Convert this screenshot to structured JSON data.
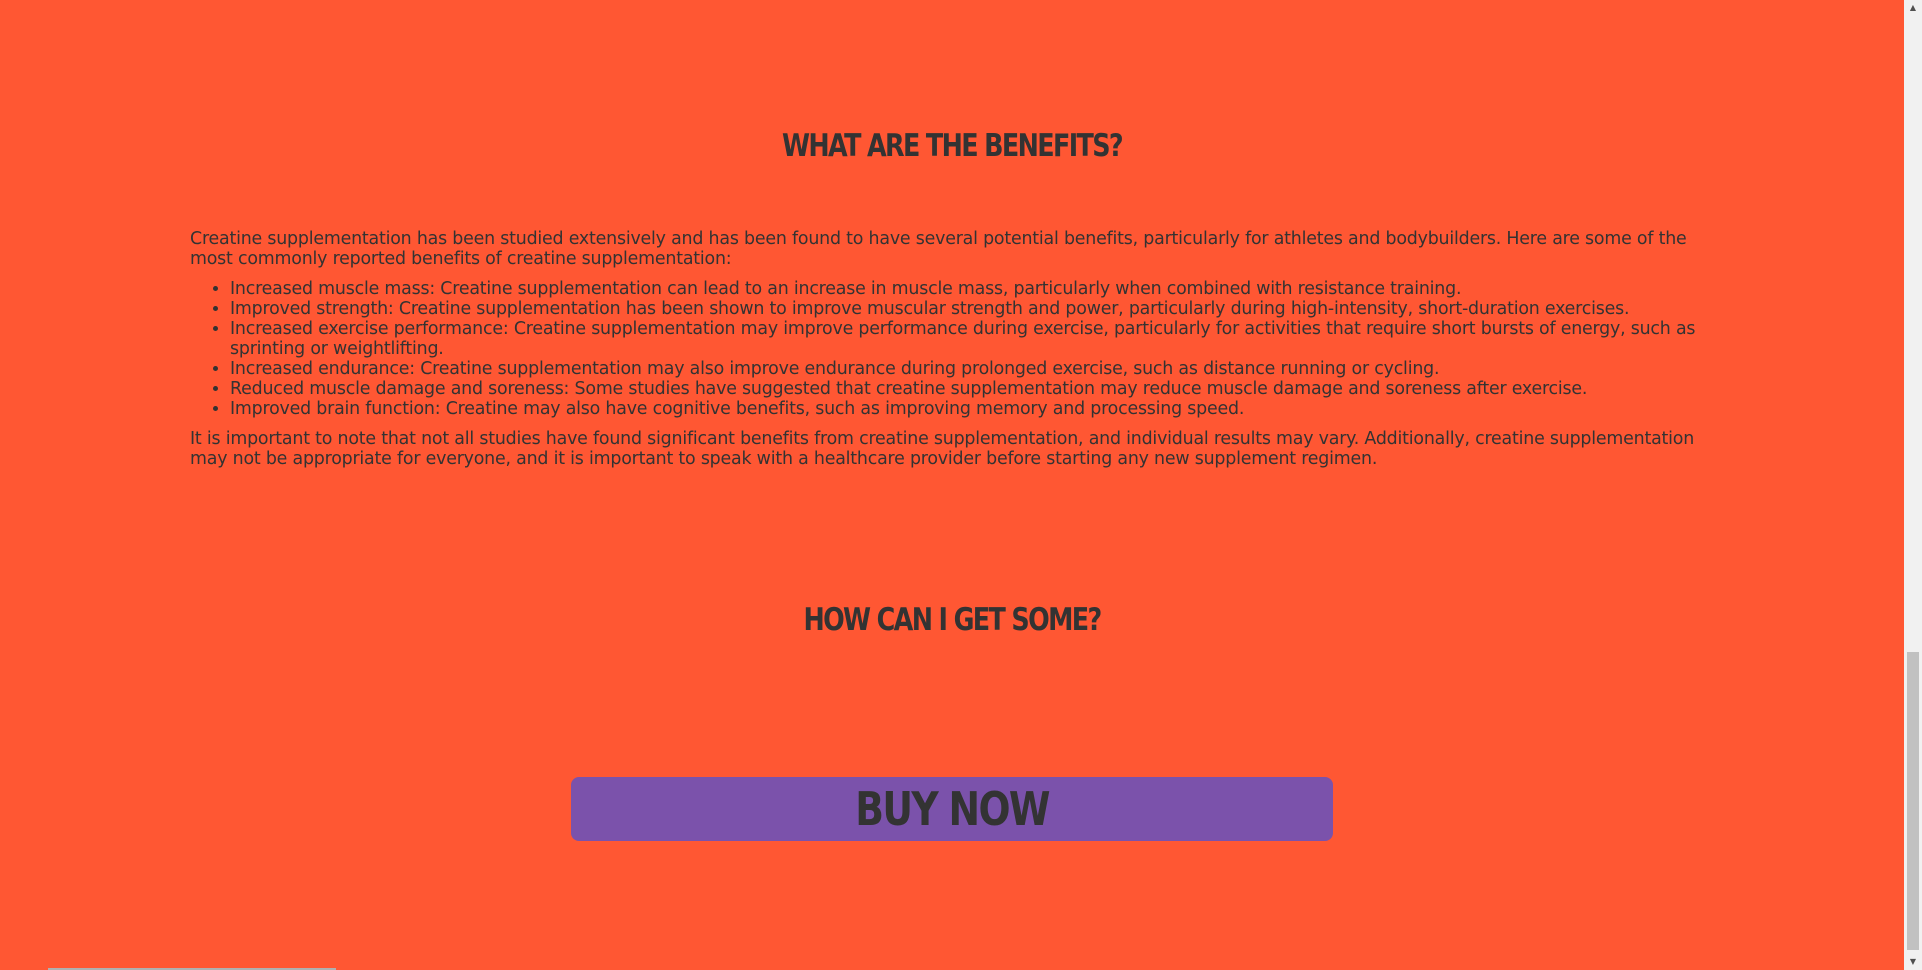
{
  "sections": {
    "benefits": {
      "heading": "WHAT ARE THE BENEFITS?",
      "intro": "Creatine supplementation has been studied extensively and has been found to have several potential benefits, particularly for athletes and bodybuilders. Here are some of the most commonly reported benefits of creatine supplementation:",
      "items": [
        "Increased muscle mass: Creatine supplementation can lead to an increase in muscle mass, particularly when combined with resistance training.",
        "Improved strength: Creatine supplementation has been shown to improve muscular strength and power, particularly during high-intensity, short-duration exercises.",
        "Increased exercise performance: Creatine supplementation may improve performance during exercise, particularly for activities that require short bursts of energy, such as sprinting or weightlifting.",
        "Increased endurance: Creatine supplementation may also improve endurance during prolonged exercise, such as distance running or cycling.",
        "Reduced muscle damage and soreness: Some studies have suggested that creatine supplementation may reduce muscle damage and soreness after exercise.",
        "Improved brain function: Creatine may also have cognitive benefits, such as improving memory and processing speed."
      ],
      "note": "It is important to note that not all studies have found significant benefits from creatine supplementation, and individual results may vary. Additionally, creatine supplementation may not be appropriate for everyone, and it is important to speak with a healthcare provider before starting any new supplement regimen."
    },
    "purchase": {
      "heading": "HOW CAN I GET SOME?",
      "button_label": "BUY NOW"
    }
  },
  "colors": {
    "background": "#ff5733",
    "text": "#333333",
    "button": "#7b52ab"
  },
  "icons": {
    "scroll_up": "arrow-up-icon",
    "scroll_down": "arrow-down-icon"
  }
}
